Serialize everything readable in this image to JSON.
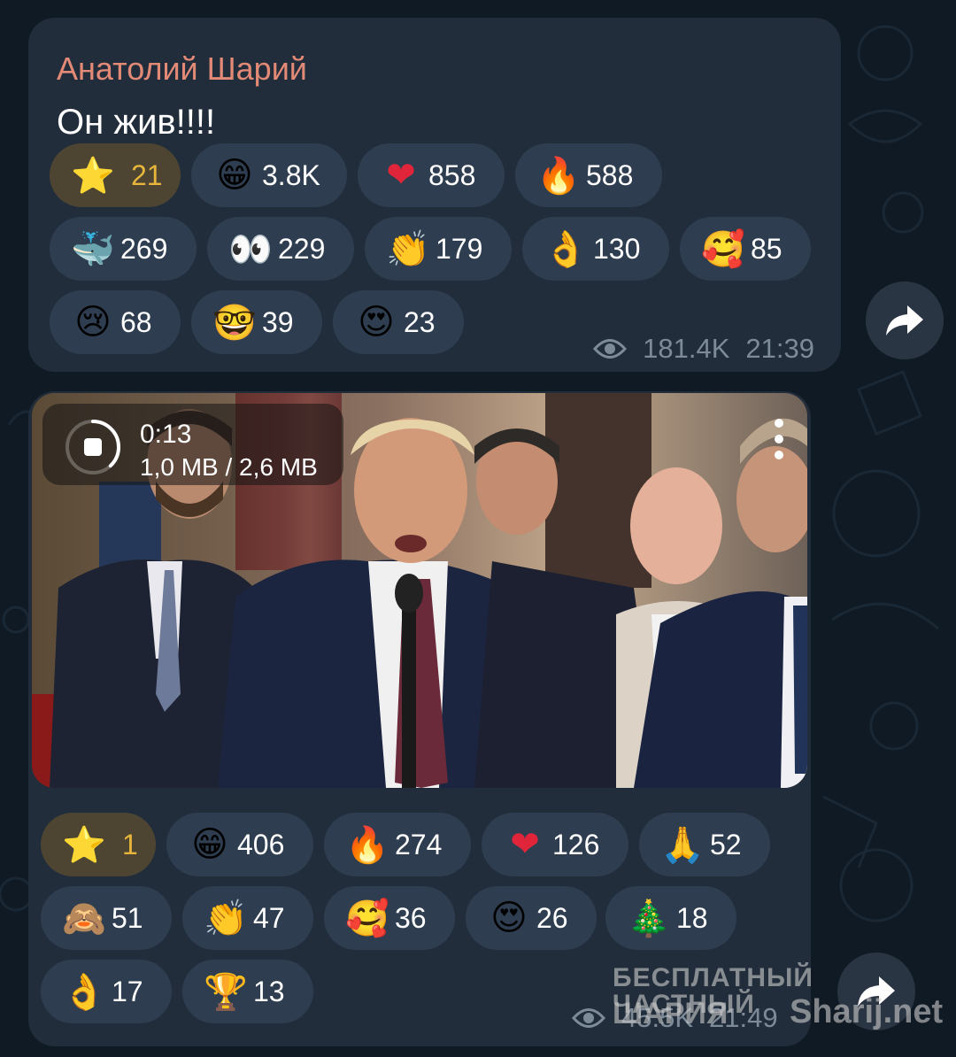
{
  "messages": [
    {
      "sender": "Анатолий Шарий",
      "text": "Он жив!!!!",
      "reactions": [
        {
          "icon": "star-icon",
          "emoji": "⭐",
          "count": "21"
        },
        {
          "icon": "grinning-face-icon",
          "emoji": "😁",
          "count": "3.8K"
        },
        {
          "icon": "heart-icon",
          "emoji": "❤",
          "count": "858"
        },
        {
          "icon": "fire-icon",
          "emoji": "🔥",
          "count": "588"
        },
        {
          "icon": "whale-icon",
          "emoji": "🐳",
          "count": "269"
        },
        {
          "icon": "eyes-icon",
          "emoji": "👀",
          "count": "229"
        },
        {
          "icon": "clapping-hands-icon",
          "emoji": "👏",
          "count": "179"
        },
        {
          "icon": "ok-hand-icon",
          "emoji": "👌",
          "count": "130"
        },
        {
          "icon": "smiling-face-hearts-icon",
          "emoji": "🥰",
          "count": "85"
        },
        {
          "icon": "crying-face-icon",
          "emoji": "😢",
          "count": "68"
        },
        {
          "icon": "nerd-face-icon",
          "emoji": "🤓",
          "count": "39"
        },
        {
          "icon": "heart-eyes-icon",
          "emoji": "😍",
          "count": "23"
        }
      ],
      "views": "181.4K",
      "time": "21:39"
    },
    {
      "video": {
        "duration": "0:13",
        "download_progress": "1,0 MB / 2,6 MB",
        "progress_fraction": 0.38
      },
      "reactions": [
        {
          "icon": "star-icon",
          "emoji": "⭐",
          "count": "1"
        },
        {
          "icon": "grinning-face-icon",
          "emoji": "😁",
          "count": "406"
        },
        {
          "icon": "fire-icon",
          "emoji": "🔥",
          "count": "274"
        },
        {
          "icon": "heart-icon",
          "emoji": "❤",
          "count": "126"
        },
        {
          "icon": "folded-hands-icon",
          "emoji": "🙏",
          "count": "52"
        },
        {
          "icon": "see-no-evil-monkey-icon",
          "emoji": "🙈",
          "count": "51"
        },
        {
          "icon": "clapping-hands-icon",
          "emoji": "👏",
          "count": "47"
        },
        {
          "icon": "smiling-face-hearts-icon",
          "emoji": "🥰",
          "count": "36"
        },
        {
          "icon": "heart-eyes-icon",
          "emoji": "😍",
          "count": "26"
        },
        {
          "icon": "christmas-tree-icon",
          "emoji": "🎄",
          "count": "18"
        },
        {
          "icon": "ok-hand-icon",
          "emoji": "👌",
          "count": "17"
        },
        {
          "icon": "trophy-icon",
          "emoji": "🏆",
          "count": "13"
        }
      ],
      "views": "45.5K",
      "time": "21:49"
    }
  ],
  "watermark": {
    "line1": "БЕСПЛАТНЫЙ ЧАСТНЫЙ",
    "line2": "ШАРИЯ",
    "domain": "Sharij.net"
  },
  "colors": {
    "background": "#0f1a24",
    "bubble": "#212d3b",
    "pill": "#2e3e50",
    "paid_pill": "#4d4532",
    "paid_count": "#e7b53b",
    "sender": "#e38a77",
    "meta": "#7d8a98"
  }
}
